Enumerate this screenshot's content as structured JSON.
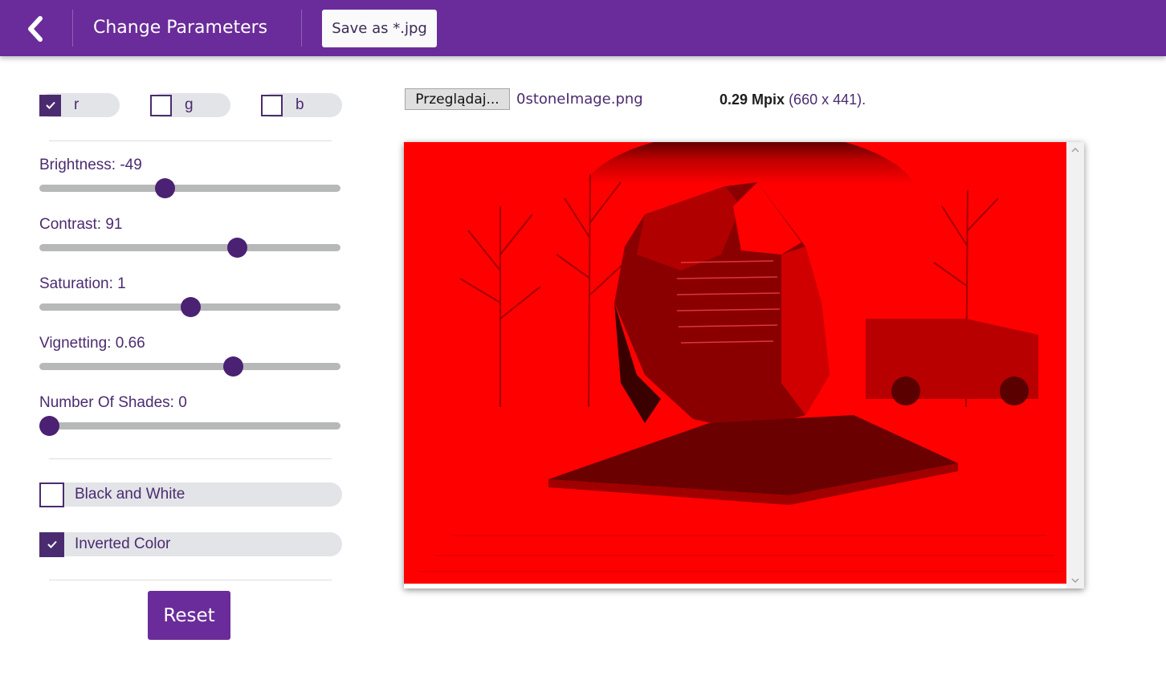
{
  "header": {
    "title": "Change Parameters",
    "save_label": "Save as *.jpg"
  },
  "channels": [
    {
      "label": "r",
      "checked": true
    },
    {
      "label": "g",
      "checked": false
    },
    {
      "label": "b",
      "checked": false
    }
  ],
  "sliders": [
    {
      "label": "Brightness: -49",
      "fraction": 0.41
    },
    {
      "label": "Contrast: 91",
      "fraction": 0.667
    },
    {
      "label": "Saturation: 1",
      "fraction": 0.5
    },
    {
      "label": "Vignetting: 0.66",
      "fraction": 0.652
    },
    {
      "label": "Number Of Shades: 0",
      "fraction": 0.0
    }
  ],
  "options": {
    "black_white": {
      "label": "Black and White",
      "checked": false
    },
    "inverted": {
      "label": "Inverted Color",
      "checked": true
    }
  },
  "reset_label": "Reset",
  "file": {
    "browse_label": "Przeglądaj...",
    "name": "0stoneImage.png",
    "mpix": "0.29 Mpix",
    "dims": "(660 x 441)."
  },
  "colors": {
    "header_bg": "#6a2c9a",
    "accent": "#4b2173",
    "image_tint": "#ff0000"
  },
  "icons": {
    "back": "chevron-left-icon",
    "check": "checkmark-icon",
    "scroll_up": "chevron-up-icon",
    "scroll_down": "chevron-down-icon"
  }
}
